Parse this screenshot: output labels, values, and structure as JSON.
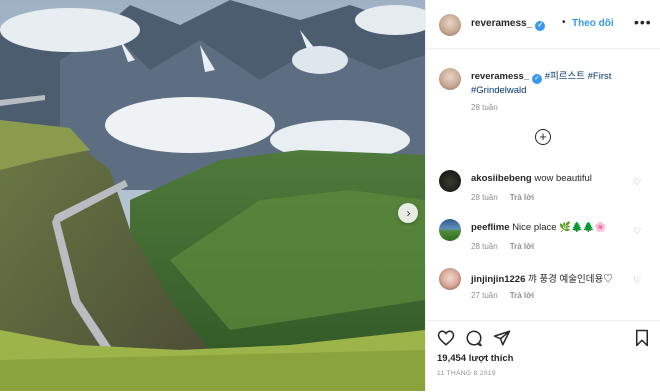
{
  "post": {
    "username": "reveramess_",
    "follow_label": "Theo dõi",
    "separator": "•",
    "more_label": "•••",
    "caption": {
      "username": "reveramess_",
      "text_prefix": " ",
      "tags": [
        "#피르스트",
        "#First",
        "#Grindelwald"
      ],
      "time": "28 tuần"
    },
    "load_more_label": "+",
    "comments": [
      {
        "username": "akosiibebeng",
        "text": "wow beautiful",
        "time": "28 tuần",
        "reply_label": "Trả lời"
      },
      {
        "username": "peeflime",
        "text": "Nice place 🌿🌲🌲🌸",
        "time": "28 tuần",
        "reply_label": "Trả lời"
      },
      {
        "username": "jinjinjin1226",
        "text": "꺄 풍경 예술인데용♡",
        "time": "27 tuần",
        "reply_label": "Trả lời"
      }
    ],
    "likes": "19,454 lượt thích",
    "date": "11 THÁNG 8 2019"
  },
  "icons": {
    "next": "chevron-right-icon",
    "verified": "verified-check-icon",
    "heart": "heart-icon",
    "comment": "comment-icon",
    "share": "share-icon",
    "save": "bookmark-icon",
    "plus": "plus-circle-icon"
  },
  "colors": {
    "link": "#3897f0",
    "text": "#262626",
    "muted": "#8e8e8e",
    "hashtag": "#003569"
  }
}
